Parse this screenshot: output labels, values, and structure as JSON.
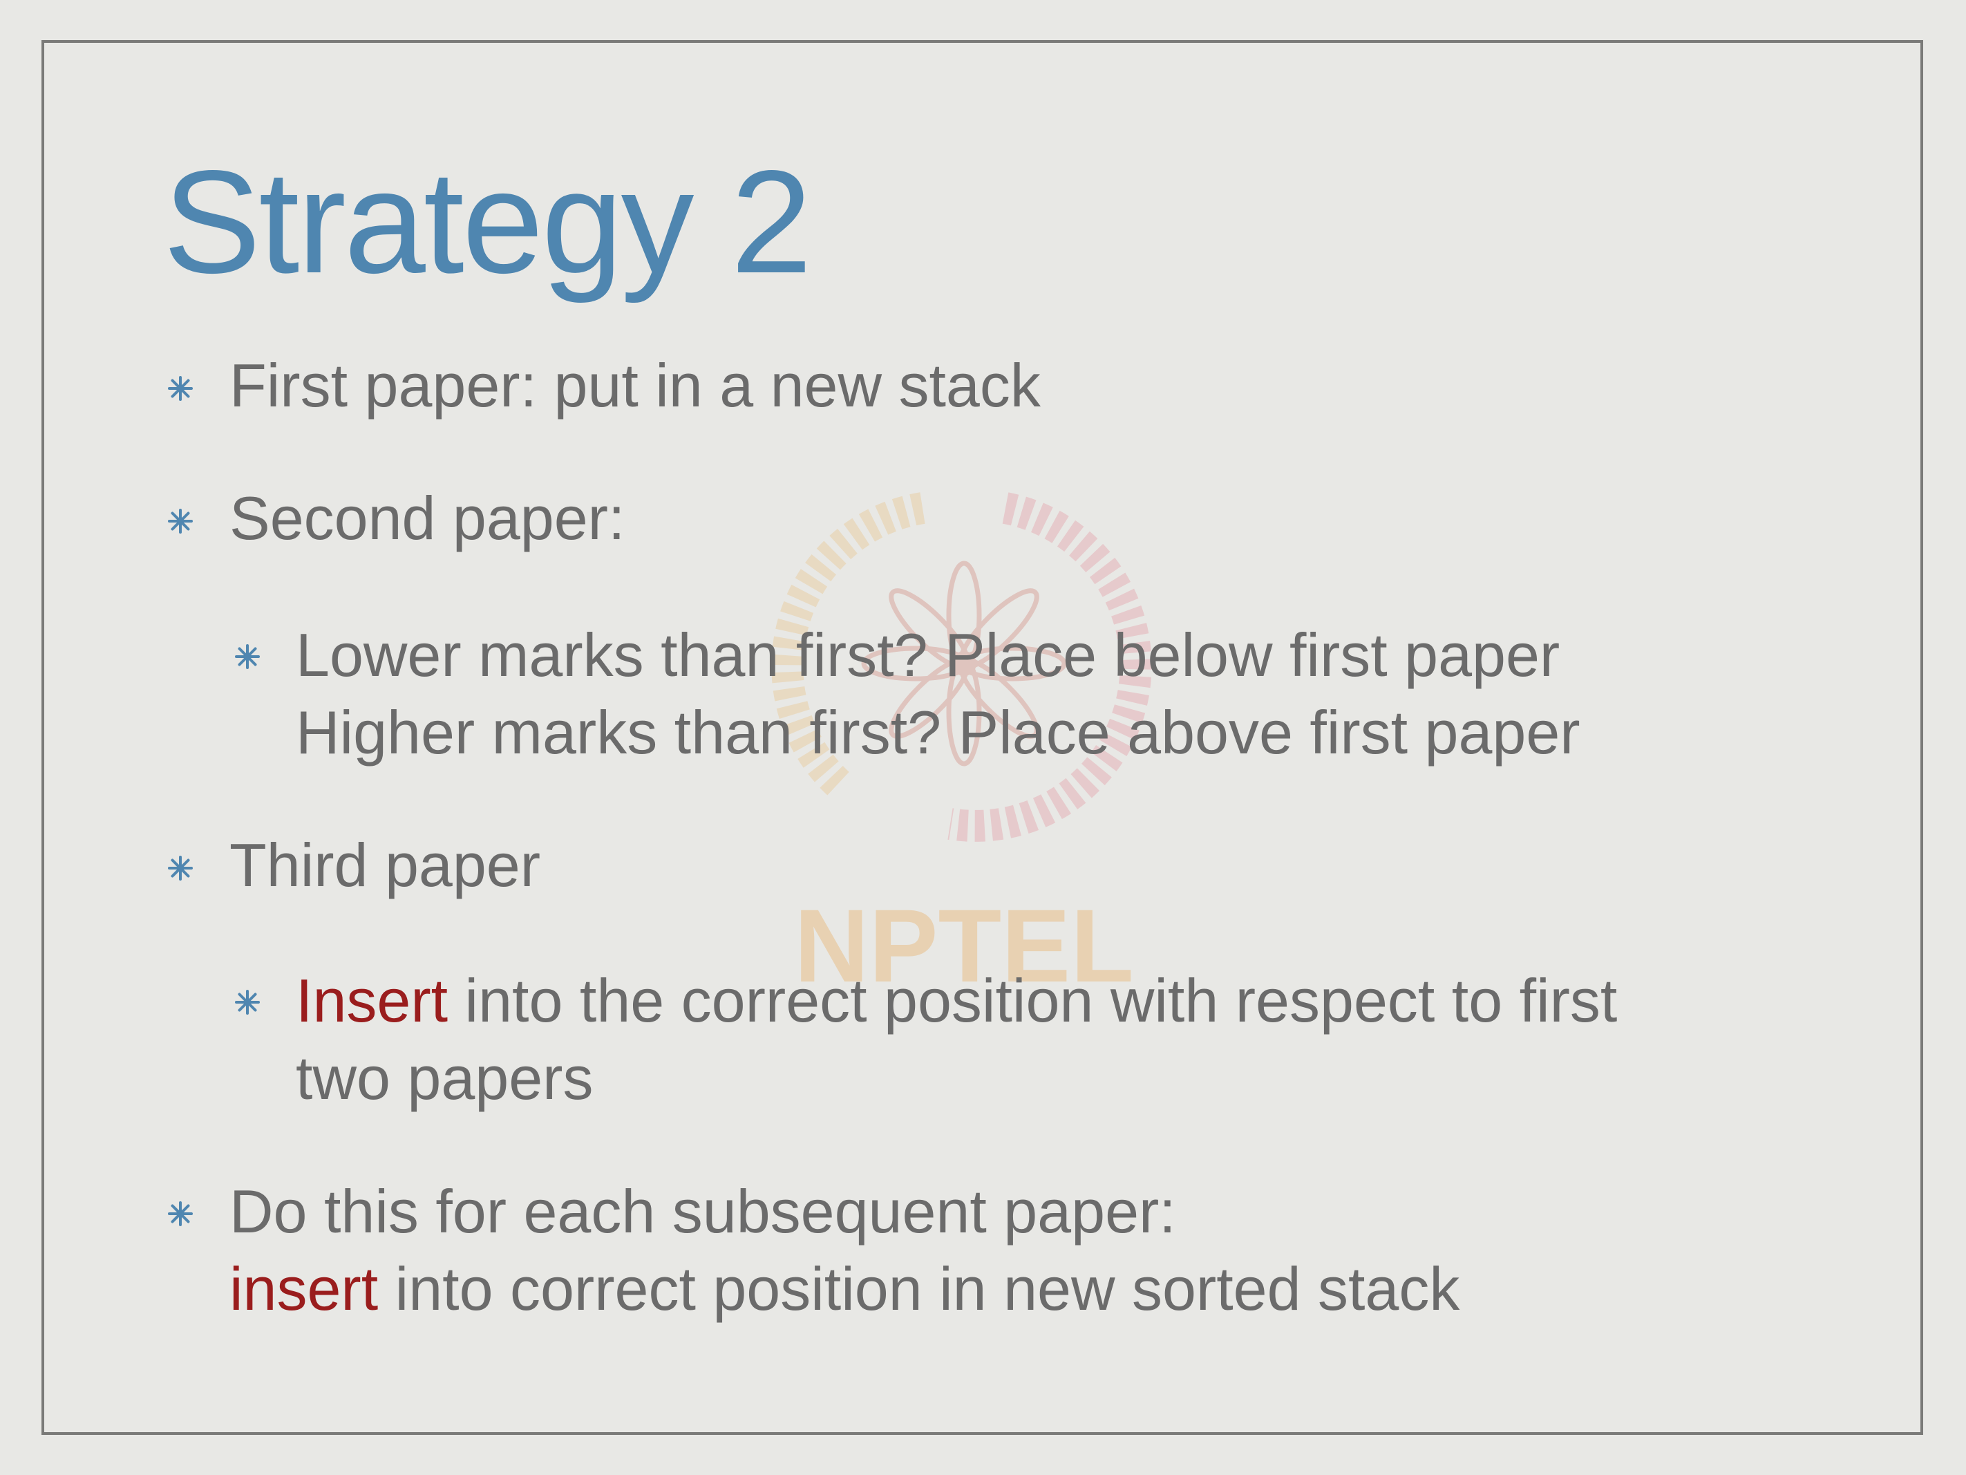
{
  "slide": {
    "title": "Strategy 2",
    "watermark_text": "NPTEL",
    "colors": {
      "title": "#4f86b0",
      "body_text": "#6b6b6b",
      "keyword": "#9a1d1d",
      "background": "#e8e8e5",
      "frame": "#7a7a78"
    }
  },
  "bullets": {
    "b1": {
      "text": "First paper: put in a new stack"
    },
    "b2": {
      "text": "Second paper:"
    },
    "b2a": {
      "line1": "Lower marks than first? Place below first paper",
      "line2": "Higher marks than first? Place above first paper"
    },
    "b3": {
      "text": "Third paper"
    },
    "b3a": {
      "keyword": "Insert",
      "line1_rest": " into the correct position with respect to first",
      "line2": "two papers"
    },
    "b4": {
      "line1": "Do this for each subsequent paper:",
      "keyword": "insert",
      "line2_rest": " into correct position in new sorted stack"
    }
  },
  "icons": {
    "bullet": "asterisk-bullet-icon",
    "watermark": "nptel-logo"
  }
}
